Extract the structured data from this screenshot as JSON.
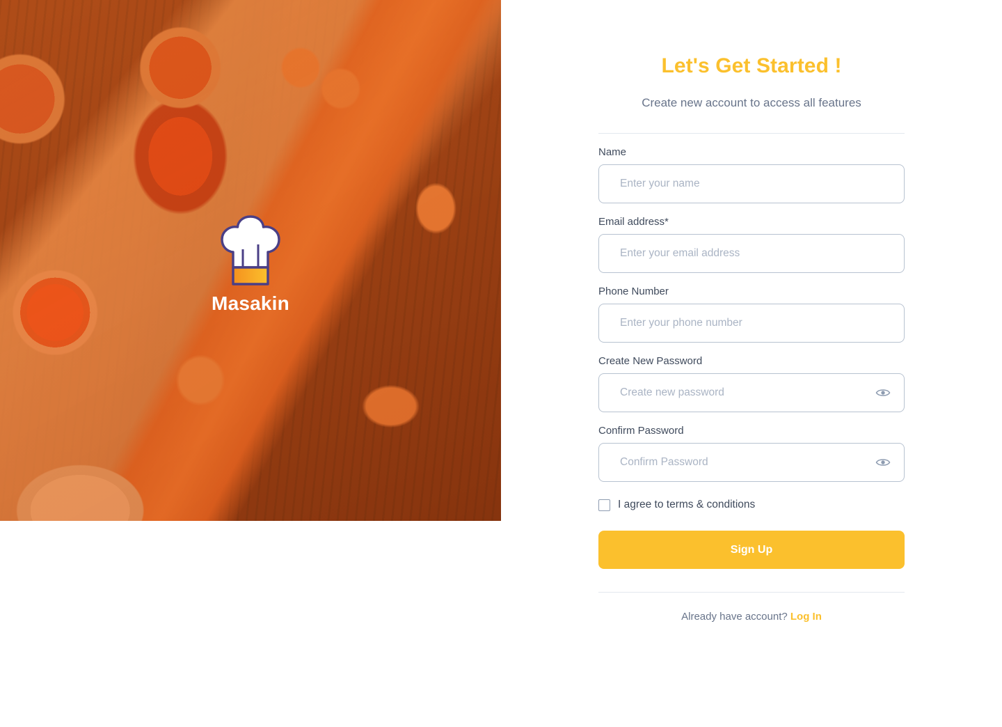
{
  "brand": {
    "name": "Masakin",
    "logo_icon": "chef-hat-icon",
    "hat_outline_color": "#4a3f86",
    "hat_fill_color": "#ffffff",
    "hat_band_color_start": "#f5a623",
    "hat_band_color_end": "#fbc02d"
  },
  "hero": {
    "alt": "grilled food on wooden board with sauce bowls",
    "overlay_color": "#e8761f"
  },
  "header": {
    "title": "Let's Get Started !",
    "subtitle": "Create new account to access all features",
    "title_color": "#fbc02d"
  },
  "form": {
    "fields": [
      {
        "key": "name",
        "label": "Name",
        "placeholder": "Enter your name",
        "value": "",
        "type": "text",
        "has_eye_icon": false
      },
      {
        "key": "email",
        "label": "Email address*",
        "placeholder": "Enter your email address",
        "value": "",
        "type": "email",
        "has_eye_icon": false
      },
      {
        "key": "phone",
        "label": "Phone Number",
        "placeholder": "Enter your phone number",
        "value": "",
        "type": "tel",
        "has_eye_icon": false
      },
      {
        "key": "password",
        "label": "Create New Password",
        "placeholder": "Create new password",
        "value": "",
        "type": "password",
        "has_eye_icon": true
      },
      {
        "key": "confirm_password",
        "label": "Confirm Password",
        "placeholder": "Confirm Password",
        "value": "",
        "type": "password",
        "has_eye_icon": true
      }
    ],
    "terms": {
      "label": "I agree to terms & conditions",
      "checked": false,
      "checkbox_icon": "checkbox-unchecked-icon"
    },
    "submit_label": "Sign Up",
    "submit_color": "#fbc02d"
  },
  "footer": {
    "prompt": "Already have account?",
    "link_label": "Log In",
    "link_color": "#fbc02d"
  },
  "icons": {
    "eye": "eye-icon"
  }
}
